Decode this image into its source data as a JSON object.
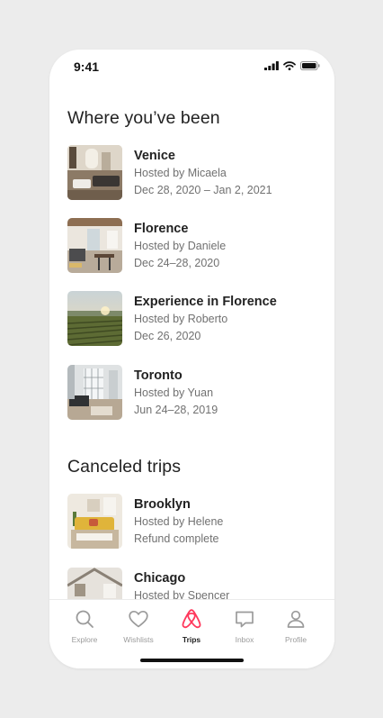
{
  "status_bar": {
    "time": "9:41"
  },
  "past_trips": {
    "title": "Where you’ve been",
    "items": [
      {
        "title": "Venice",
        "host": "Hosted by Micaela",
        "dates": "Dec 28, 2020 – Jan 2, 2021",
        "image": "interior-living-room-photo"
      },
      {
        "title": "Florence",
        "host": "Hosted by Daniele",
        "dates": "Dec 24–28, 2020",
        "image": "interior-apartment-photo"
      },
      {
        "title": "Experience in Florence",
        "host": "Hosted by Roberto",
        "dates": "Dec 26, 2020",
        "image": "vineyard-landscape-photo"
      },
      {
        "title": "Toronto",
        "host": "Hosted by Yuan",
        "dates": "Jun 24–28, 2019",
        "image": "loft-interior-photo"
      }
    ]
  },
  "canceled_trips": {
    "title": "Canceled trips",
    "items": [
      {
        "title": "Brooklyn",
        "host": "Hosted by Helene",
        "status": "Refund complete",
        "image": "yellow-sofa-room-photo"
      },
      {
        "title": "Chicago",
        "host": "Hosted by Spencer",
        "image": "attic-room-photo"
      }
    ]
  },
  "tab_bar": {
    "tabs": [
      {
        "label": "Explore",
        "icon": "search-icon"
      },
      {
        "label": "Wishlists",
        "icon": "heart-icon"
      },
      {
        "label": "Trips",
        "icon": "airbnb-logo-icon",
        "active": true
      },
      {
        "label": "Inbox",
        "icon": "chat-bubble-icon"
      },
      {
        "label": "Profile",
        "icon": "person-icon"
      }
    ]
  },
  "colors": {
    "brand": "#FF385C",
    "text": "#222222",
    "muted": "#717171",
    "inactive_tab": "#9B9B9B"
  }
}
